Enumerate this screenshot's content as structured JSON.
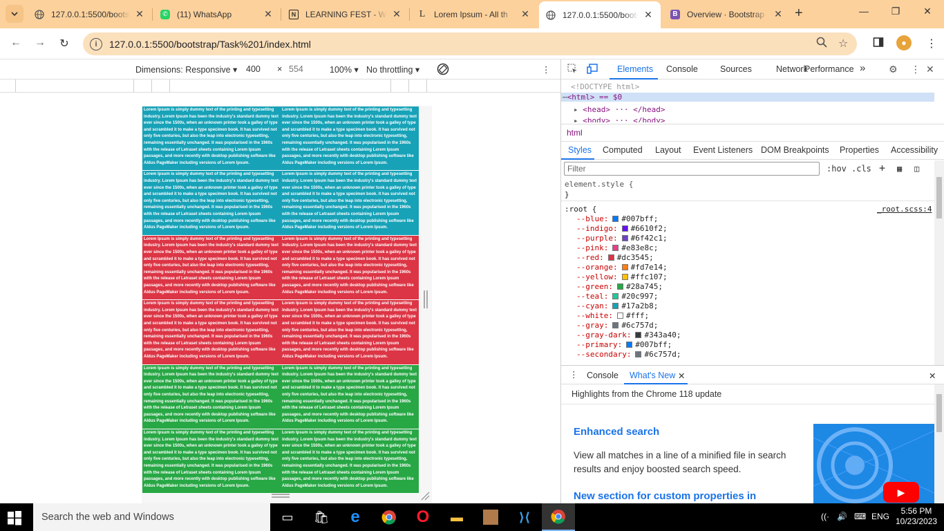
{
  "browser": {
    "tabs": [
      {
        "title": "127.0.0.1:5500/bootstrap",
        "icon": "globe-icon",
        "active": false
      },
      {
        "title": "(11) WhatsApp",
        "icon": "whatsapp-icon",
        "active": false
      },
      {
        "title": "LEARNING FEST - Wi",
        "icon": "notion-icon",
        "active": false
      },
      {
        "title": "Lorem Ipsum - All th",
        "icon": "lipsum-icon",
        "active": false
      },
      {
        "title": "127.0.0.1:5500/bootst",
        "icon": "globe-icon",
        "active": true
      },
      {
        "title": "Overview · Bootstrap",
        "icon": "bootstrap-icon",
        "active": false
      }
    ],
    "url": "127.0.0.1:5500/bootstrap/Task%201/index.html",
    "accent_color": "#fcd19c"
  },
  "device_toolbar": {
    "dimensions_label": "Dimensions: Responsive",
    "width": "400",
    "times": "×",
    "height": "554",
    "zoom": "100%",
    "throttling": "No throttling"
  },
  "page": {
    "cell_text": "Lorem Ipsum is simply dummy text of the printing and typesetting industry. Lorem Ipsum has been the industry's standard dummy text ever since the 1500s, when an unknown printer took a galley of type and scrambled it to make a type specimen book. It has survived not only five centuries, but also the leap into electronic typesetting, remaining essentially unchanged. It was popularised in the 1960s with the release of Letraset sheets containing Lorem Ipsum passages, and more recently with desktop publishing software like Aldus PageMaker including versions of Lorem Ipsum.",
    "rows": [
      {
        "color_class": "bg-info",
        "color": "#17a2b8"
      },
      {
        "color_class": "bg-info",
        "color": "#17a2b8"
      },
      {
        "color_class": "bg-danger",
        "color": "#dc3545"
      },
      {
        "color_class": "bg-danger",
        "color": "#dc3545"
      },
      {
        "color_class": "bg-success",
        "color": "#28a745"
      },
      {
        "color_class": "bg-success",
        "color": "#28a745"
      }
    ]
  },
  "devtools": {
    "tabs": [
      "Elements",
      "Console",
      "Sources",
      "Network",
      "Performance"
    ],
    "more_tabs": "»",
    "elements": {
      "doctype": "<!DOCTYPE html>",
      "html_line": "<html> == $0",
      "head_line": "<head> ··· </head>",
      "body_line": "<body> ··· </body>"
    },
    "breadcrumb": "html",
    "style_tabs": [
      "Styles",
      "Computed",
      "Layout",
      "Event Listeners",
      "DOM Breakpoints",
      "Properties",
      "Accessibility"
    ],
    "filter_placeholder": "Filter",
    "hov": ":hov",
    "cls": ".cls",
    "element_style": "element.style {",
    "close_brace": "}",
    "root_selector": ":root {",
    "root_source": "_root.scss:4",
    "css_vars": [
      {
        "name": "--blue:",
        "value": "#007bff;",
        "swatch": "#007bff"
      },
      {
        "name": "--indigo:",
        "value": "#6610f2;",
        "swatch": "#6610f2"
      },
      {
        "name": "--purple:",
        "value": "#6f42c1;",
        "swatch": "#6f42c1"
      },
      {
        "name": "--pink:",
        "value": "#e83e8c;",
        "swatch": "#e83e8c"
      },
      {
        "name": "--red:",
        "value": "#dc3545;",
        "swatch": "#dc3545"
      },
      {
        "name": "--orange:",
        "value": "#fd7e14;",
        "swatch": "#fd7e14"
      },
      {
        "name": "--yellow:",
        "value": "#ffc107;",
        "swatch": "#ffc107"
      },
      {
        "name": "--green:",
        "value": "#28a745;",
        "swatch": "#28a745"
      },
      {
        "name": "--teal:",
        "value": "#20c997;",
        "swatch": "#20c997"
      },
      {
        "name": "--cyan:",
        "value": "#17a2b8;",
        "swatch": "#17a2b8"
      },
      {
        "name": "--white:",
        "value": "#fff;",
        "swatch": "#ffffff"
      },
      {
        "name": "--gray:",
        "value": "#6c757d;",
        "swatch": "#6c757d"
      },
      {
        "name": "--gray-dark:",
        "value": "#343a40;",
        "swatch": "#343a40"
      },
      {
        "name": "--primary:",
        "value": "#007bff;",
        "swatch": "#007bff"
      },
      {
        "name": "--secondary:",
        "value": "#6c757d;",
        "swatch": "#6c757d"
      }
    ],
    "drawer_tabs": [
      "Console",
      "What's New"
    ],
    "whats_new": {
      "headline": "Highlights from the Chrome 118 update",
      "feature_title": "Enhanced search",
      "feature_desc": "View all matches in a line of a minified file in search results and enjoy boosted search speed.",
      "feature_title2": "New section for custom properties in"
    }
  },
  "taskbar": {
    "search_placeholder": "Search the web and Windows",
    "language": "ENG",
    "time": "5:56 PM",
    "date": "10/23/2023"
  }
}
